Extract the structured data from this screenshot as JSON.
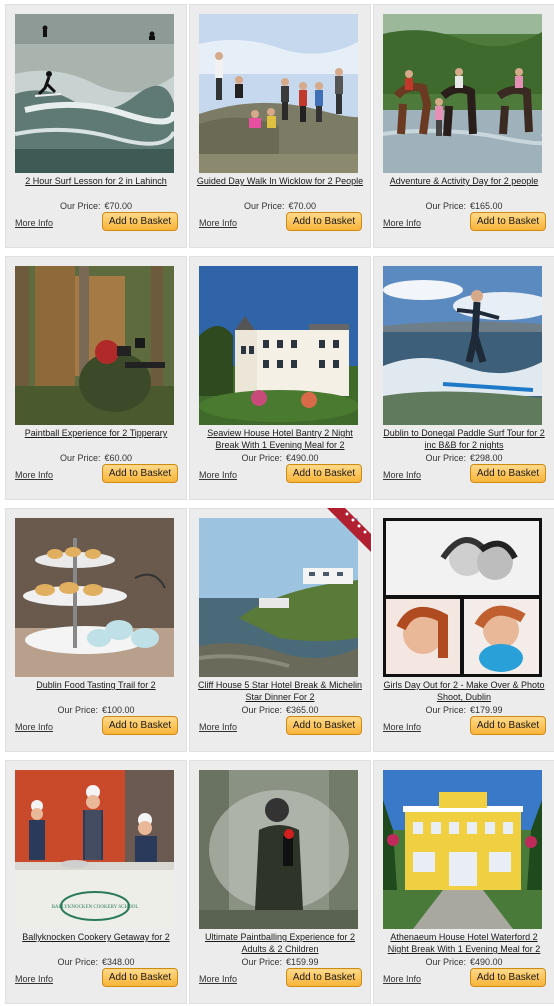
{
  "labels": {
    "price_label": "Our Price:",
    "more_info": "More Info",
    "add_to_basket": "Add to Basket"
  },
  "products": [
    {
      "title": "2 Hour Surf Lesson for 2 in Lahinch",
      "price": "€70.00",
      "image": "surf-lesson-photo"
    },
    {
      "title": "Guided Day Walk In Wicklow for 2 People",
      "price": "€70.00",
      "image": "hiking-group-photo"
    },
    {
      "title": "Adventure & Activity Day for 2 people",
      "price": "€165.00",
      "image": "horse-riding-photo"
    },
    {
      "title": "Paintball Experience for 2 Tipperary",
      "price": "€60.00",
      "image": "paintball-photo"
    },
    {
      "title": "Seaview House Hotel Bantry 2 Night Break With 1 Evening Meal for 2",
      "price": "€490.00",
      "image": "seaview-hotel-photo"
    },
    {
      "title": "Dublin to Donegal Paddle Surf Tour for 2 inc B&B for 2 nights",
      "price": "€298.00",
      "image": "paddle-surf-photo"
    },
    {
      "title": "Dublin Food Tasting Trail for 2",
      "price": "€100.00",
      "image": "cake-stand-photo"
    },
    {
      "title": "Cliff House 5 Star Hotel Break & Michelin Star Dinner For 2",
      "price": "€365.00",
      "image": "cliff-house-photo",
      "ribbon": true
    },
    {
      "title": "Girls Day Out for 2 - Make Over & Photo Shoot, Dublin",
      "price": "€179.99",
      "image": "photo-shoot-collage"
    },
    {
      "title": "Ballyknocken Cookery Getaway for 2",
      "price": "€348.00",
      "image": "cookery-school-photo",
      "sign_text": "BALLYKNOCKEN COOKERY SCHOOL"
    },
    {
      "title": "Ultimate Paintballing Experience for 2 Adults & 2 Children",
      "price": "€159.99",
      "image": "paintball-smoke-photo"
    },
    {
      "title": "Athenaeum House Hotel Waterford 2 Night Break With 1 Evening Meal for 2",
      "price": "€490.00",
      "image": "athenaeum-hotel-photo"
    }
  ]
}
